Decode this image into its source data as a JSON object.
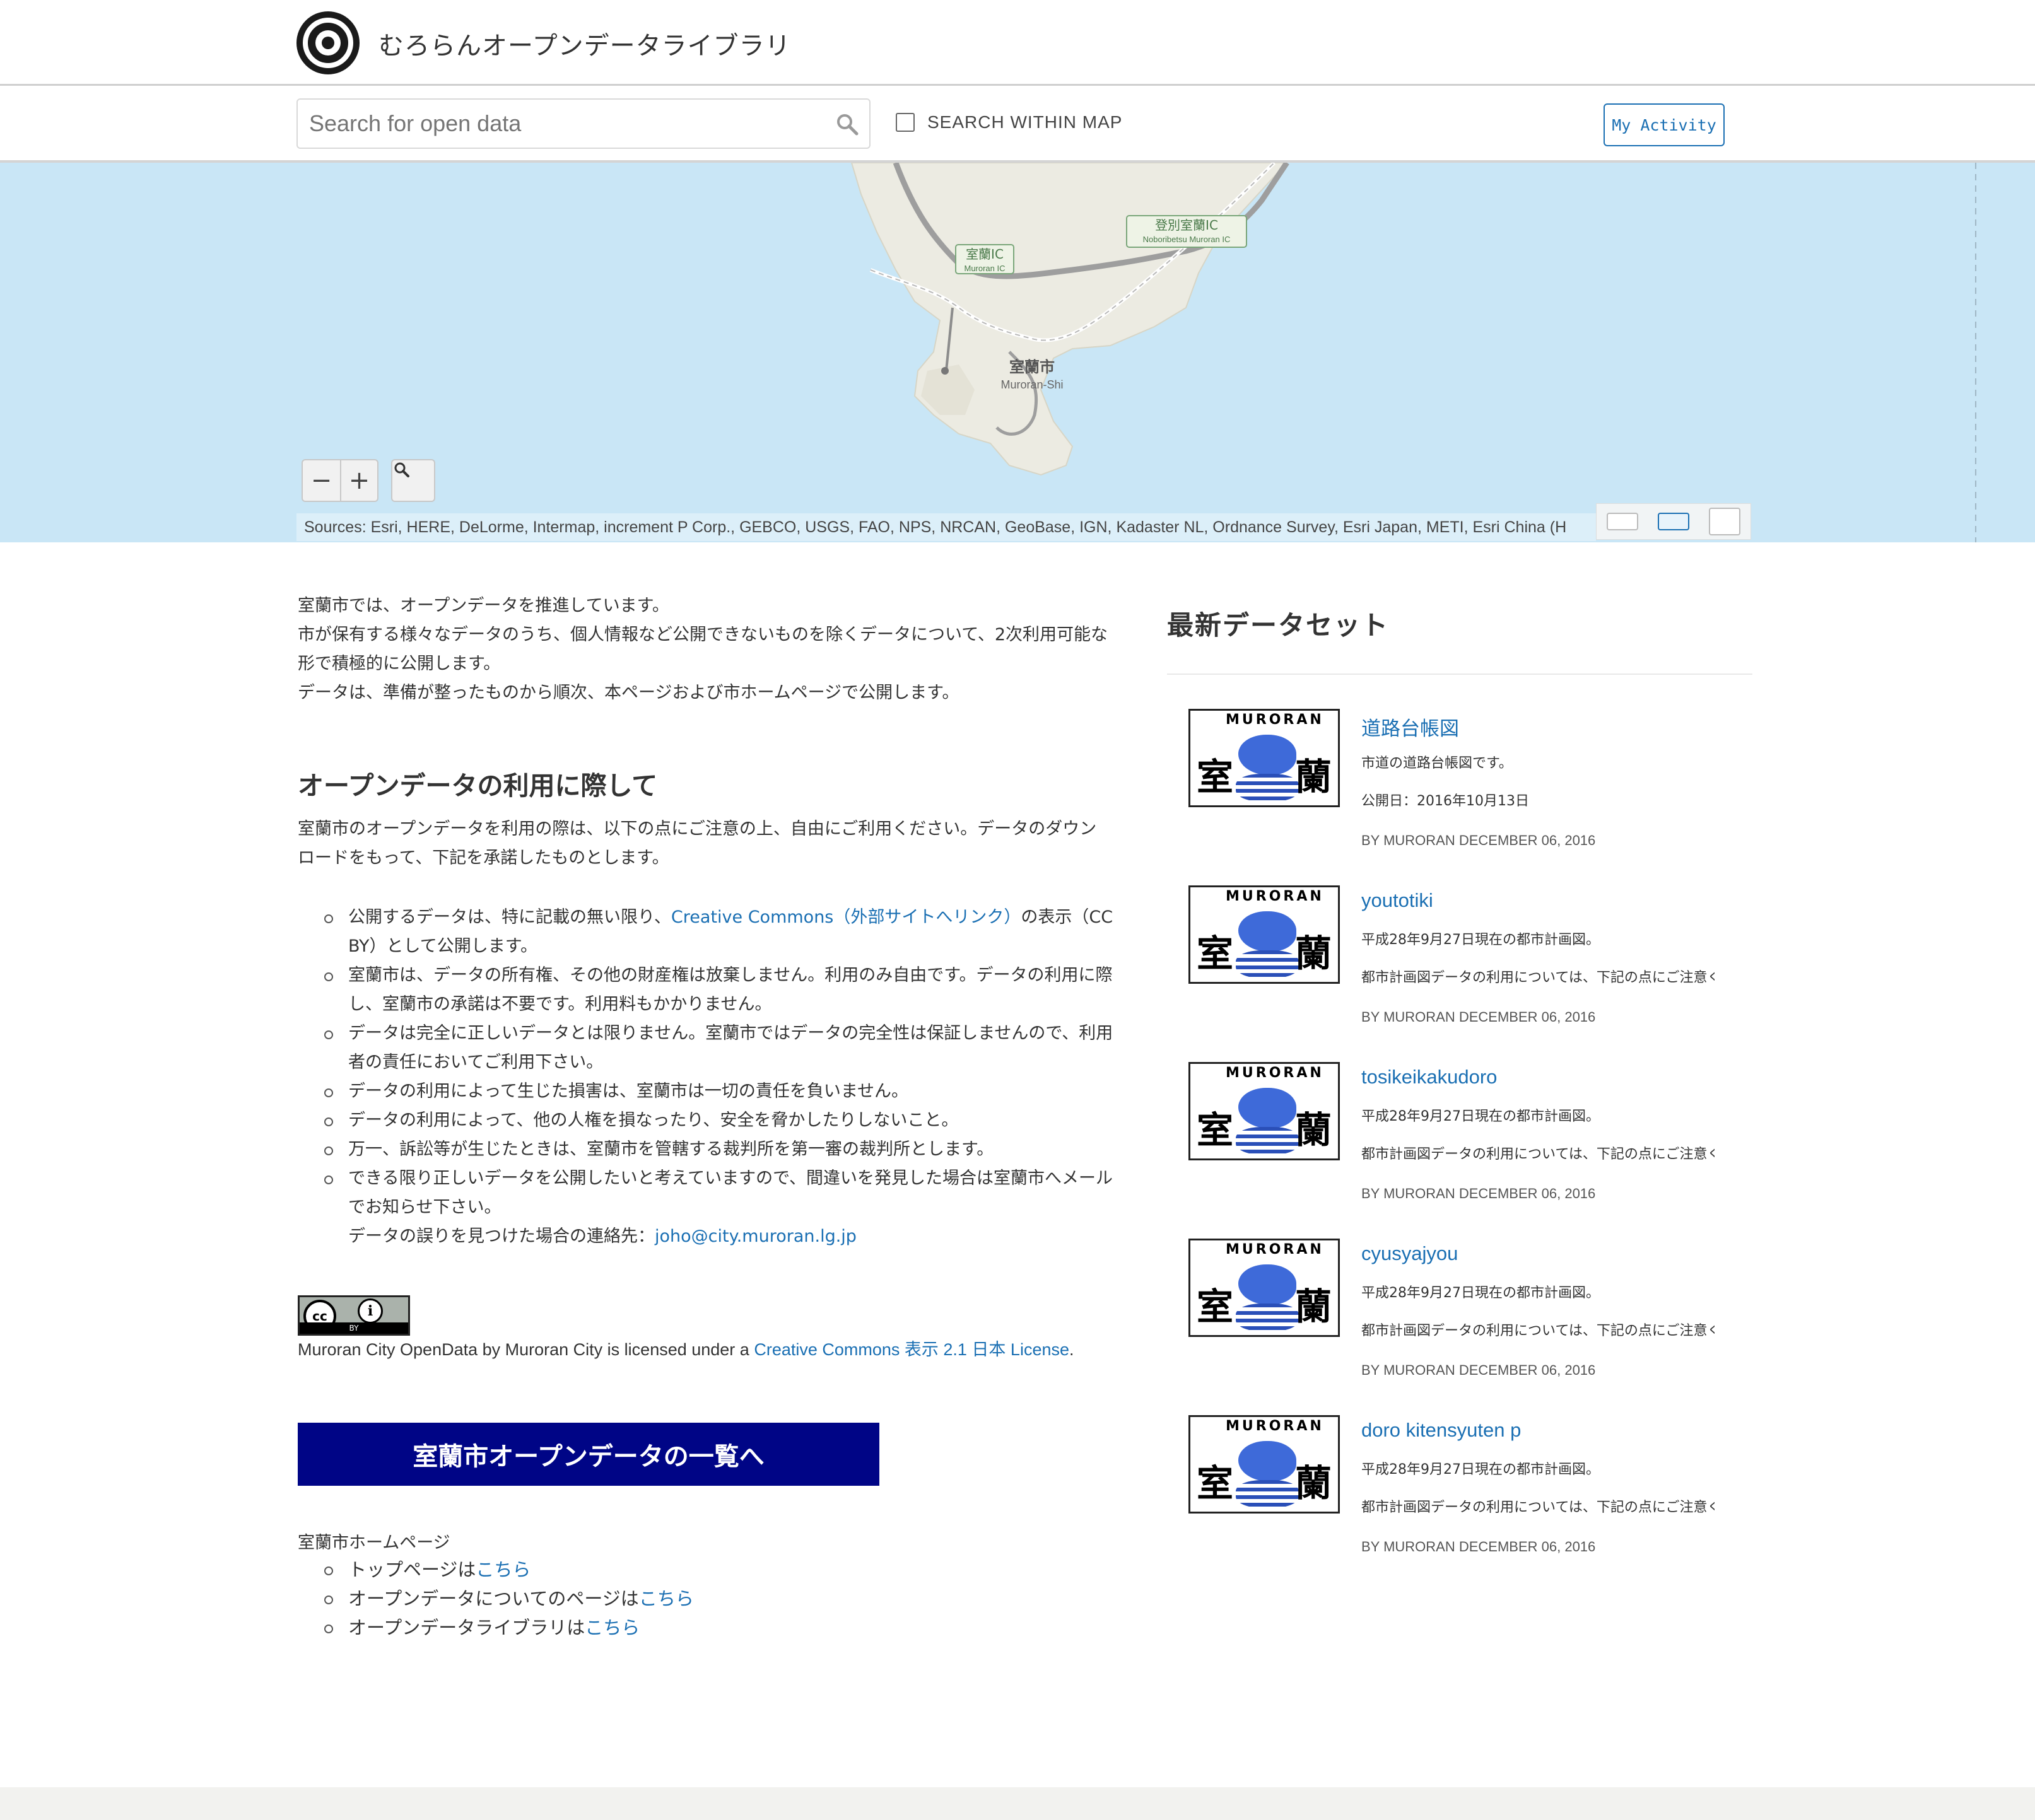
{
  "header": {
    "site_title": "むろらんオープンデータライブラリ",
    "logo_icon": "muroran-city-emblem"
  },
  "search": {
    "placeholder": "Search for open data",
    "within_map_label": "SEARCH WITHIN MAP",
    "within_map_checked": false,
    "my_activity_label": "My Activity"
  },
  "map": {
    "labels": {
      "muroran_ic_ja": "室蘭IC",
      "muroran_ic_en": "Muroran IC",
      "noboribetsu_ic_ja": "登別室蘭IC",
      "noboribetsu_ic_en": "Noboribetsu Muroran IC",
      "city_ja": "室蘭市",
      "city_en": "Muroran-Shi"
    },
    "zoom_out": "−",
    "zoom_in": "+",
    "attribution": "Sources: Esri, HERE, DeLorme, Intermap, increment P Corp., GEBCO, USGS, FAO, NPS, NRCAN, GeoBase, IGN, Kadaster NL, Ordnance Survey, Esri Japan, METI, Esri China (H"
  },
  "intro": {
    "line1": "室蘭市では、オープンデータを推進しています。",
    "line2": "市が保有する様々なデータのうち、個人情報など公開できないものを除くデータについて、2次利用可能な",
    "line3": "形で積極的に公開します。",
    "line4": "データは、準備が整ったものから順次、本ページおよび市ホームページで公開します。"
  },
  "usage": {
    "heading": "オープンデータの利用に際して",
    "text_line1": "室蘭市のオープンデータを利用の際は、以下の点にご注意の上、自由にご利用ください。データのダウン",
    "text_line2": "ロードをもって、下記を承諾したものとします。",
    "rule1_pre": "公開するデータは、特に記載の無い限り、",
    "rule1_link": "Creative Commons（外部サイトへリンク）",
    "rule1_post": "の表示（CC",
    "rule1_line2": "BY）として公開します。",
    "rule2_line1": "室蘭市は、データの所有権、その他の財産権は放棄しません。利用のみ自由です。データの利用に際",
    "rule2_line2": "し、室蘭市の承諾は不要です。利用料もかかりません。",
    "rule3_line1": "データは完全に正しいデータとは限りません。室蘭市ではデータの完全性は保証しませんので、利用",
    "rule3_line2": "者の責任においてご利用下さい。",
    "rule4": "データの利用によって生じた損害は、室蘭市は一切の責任を負いません。",
    "rule5": "データの利用によって、他の人権を損なったり、安全を脅かしたりしないこと。",
    "rule6": "万一、訴訟等が生じたときは、室蘭市を管轄する裁判所を第一審の裁判所とします。",
    "rule7_line1": "できる限り正しいデータを公開したいと考えていますので、間違いを発見した場合は室蘭市へメール",
    "rule7_line2": "でお知らせ下さい。",
    "contact_label": "データの誤りを見つけた場合の連絡先：",
    "contact_email": "joho@city.muroran.lg.jp"
  },
  "license": {
    "badge_cc": "cc",
    "badge_by_icon": "person-icon",
    "badge_band": "BY",
    "text_pre": "Muroran City OpenData by Muroran City is licensed under a ",
    "link": "Creative Commons 表示 2.1 日本 License",
    "text_post": "."
  },
  "list_button": "室蘭市オープンデータの一覧へ",
  "home": {
    "label": "室蘭市ホームページ",
    "links": [
      {
        "pre": "トップページは",
        "link": "こちら"
      },
      {
        "pre": "オープンデータについてのページは",
        "link": "こちら"
      },
      {
        "pre": "オープンデータライブラリは",
        "link": "こちら"
      }
    ]
  },
  "latest": {
    "title": "最新データセット",
    "thumb_text": {
      "arc": "MURORAN",
      "k1": "室",
      "k2": "蘭"
    },
    "datasets": [
      {
        "title": "道路台帳図",
        "desc1": "市道の道路台帳図です。",
        "desc2": "公開日：2016年10月13日",
        "meta": "BY MURORAN DECEMBER 06, 2016"
      },
      {
        "title": "youtotiki",
        "desc1": "平成28年9月27日現在の都市計画図。",
        "desc2": "都市計画図データの利用については、下記の点にご注意ください",
        "meta": "BY MURORAN DECEMBER 06, 2016"
      },
      {
        "title": "tosikeikakudoro",
        "desc1": "平成28年9月27日現在の都市計画図。",
        "desc2": "都市計画図データの利用については、下記の点にご注意ください",
        "meta": "BY MURORAN DECEMBER 06, 2016"
      },
      {
        "title": "cyusyajyou",
        "desc1": "平成28年9月27日現在の都市計画図。",
        "desc2": "都市計画図データの利用については、下記の点にご注意ください",
        "meta": "BY MURORAN DECEMBER 06, 2016"
      },
      {
        "title": "doro kitensyuten p",
        "desc1": "平成28年9月27日現在の都市計画図。",
        "desc2": "都市計画図データの利用については、下記の点にご注意ください",
        "meta": "BY MURORAN DECEMBER 06, 2016"
      }
    ]
  }
}
